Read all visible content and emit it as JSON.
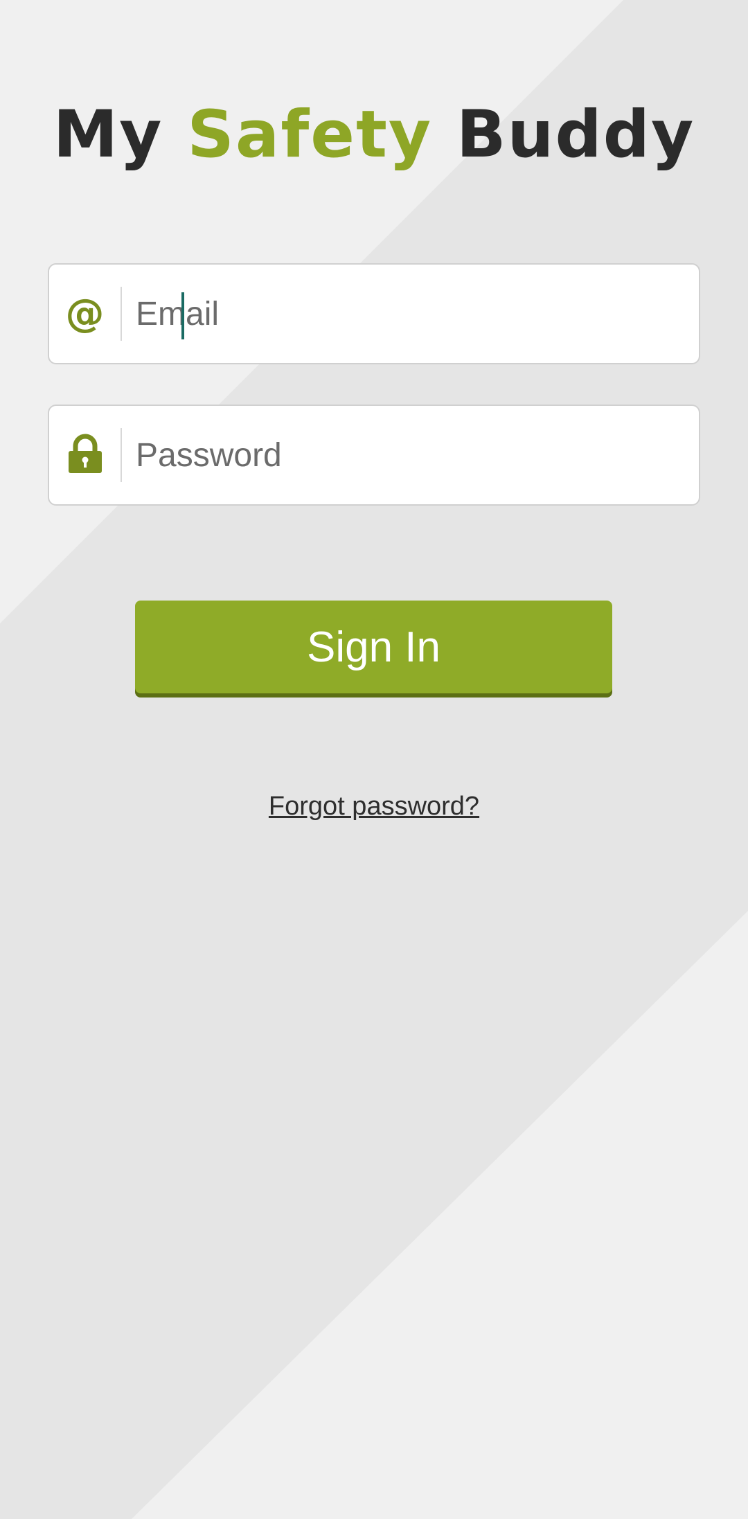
{
  "logo": {
    "part1": "My ",
    "part2": "Safety",
    "part3": " Buddy"
  },
  "email": {
    "icon": "at-icon",
    "placeholder": "Email",
    "value": ""
  },
  "password": {
    "icon": "lock-icon",
    "placeholder": "Password",
    "value": ""
  },
  "signin": {
    "label": "Sign In"
  },
  "forgot": {
    "label": "Forgot password?"
  },
  "colors": {
    "accent": "#8fab28",
    "accent_dark": "#7a8e1f",
    "text": "#2b2b2b",
    "background": "#f0f0f0",
    "band": "#e5e5e5"
  }
}
